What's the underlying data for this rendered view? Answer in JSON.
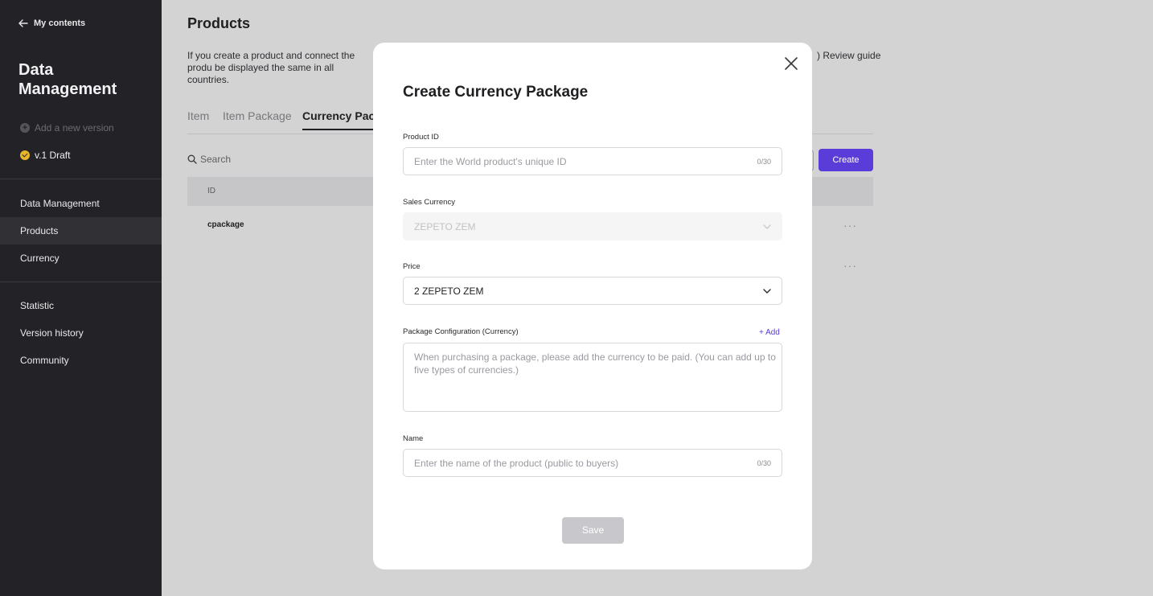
{
  "sidebar": {
    "back_label": "My contents",
    "title": "Data Management",
    "add_version": "Add a new version",
    "draft_label": "v.1 Draft",
    "nav_primary": [
      {
        "label": "Data Management"
      },
      {
        "label": "Products",
        "active": true
      },
      {
        "label": "Currency"
      }
    ],
    "nav_secondary": [
      {
        "label": "Statistic"
      },
      {
        "label": "Version history"
      },
      {
        "label": "Community"
      }
    ]
  },
  "main": {
    "title": "Products",
    "description": "If you create a product and connect the produ be displayed the same in all countries.",
    "review_guide": ") Review guide",
    "tabs": [
      {
        "label": "Item"
      },
      {
        "label": "Item Package"
      },
      {
        "label": "Currency Pack",
        "active": true
      }
    ],
    "search_label": "Search",
    "create_label": "Create",
    "table": {
      "header_id": "ID",
      "rows": [
        {
          "id": "cpackage"
        },
        {
          "id": ""
        }
      ]
    },
    "more_glyph": "···"
  },
  "modal": {
    "title": "Create Currency Package",
    "product_id": {
      "label": "Product ID",
      "placeholder": "Enter the World product's unique ID",
      "counter": "0/30"
    },
    "sales_currency": {
      "label": "Sales Currency",
      "value": "ZEPETO ZEM",
      "disabled": true
    },
    "price": {
      "label": "Price",
      "value": "2 ZEPETO ZEM"
    },
    "package_config": {
      "label": "Package Configuration (Currency)",
      "add_label": "+ Add",
      "placeholder": "When purchasing a package, please add the currency to be paid. (You can add up to five types of currencies.)"
    },
    "name": {
      "label": "Name",
      "placeholder": "Enter the name of the product (public to buyers)",
      "counter": "0/30"
    },
    "save_label": "Save"
  },
  "colors": {
    "accent": "#5a3cd8",
    "sidebar_bg": "#232327",
    "overlay_bg": "#d3d3d3"
  }
}
